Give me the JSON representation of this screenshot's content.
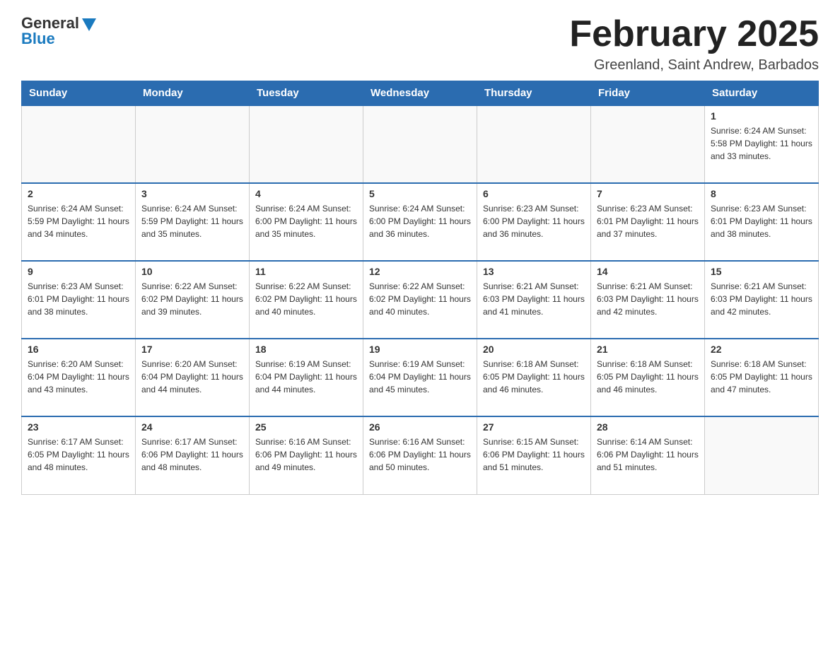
{
  "header": {
    "logo_general": "General",
    "logo_blue": "Blue",
    "month_title": "February 2025",
    "location": "Greenland, Saint Andrew, Barbados"
  },
  "calendar": {
    "days_of_week": [
      "Sunday",
      "Monday",
      "Tuesday",
      "Wednesday",
      "Thursday",
      "Friday",
      "Saturday"
    ],
    "weeks": [
      [
        {
          "day": "",
          "info": ""
        },
        {
          "day": "",
          "info": ""
        },
        {
          "day": "",
          "info": ""
        },
        {
          "day": "",
          "info": ""
        },
        {
          "day": "",
          "info": ""
        },
        {
          "day": "",
          "info": ""
        },
        {
          "day": "1",
          "info": "Sunrise: 6:24 AM\nSunset: 5:58 PM\nDaylight: 11 hours and 33 minutes."
        }
      ],
      [
        {
          "day": "2",
          "info": "Sunrise: 6:24 AM\nSunset: 5:59 PM\nDaylight: 11 hours and 34 minutes."
        },
        {
          "day": "3",
          "info": "Sunrise: 6:24 AM\nSunset: 5:59 PM\nDaylight: 11 hours and 35 minutes."
        },
        {
          "day": "4",
          "info": "Sunrise: 6:24 AM\nSunset: 6:00 PM\nDaylight: 11 hours and 35 minutes."
        },
        {
          "day": "5",
          "info": "Sunrise: 6:24 AM\nSunset: 6:00 PM\nDaylight: 11 hours and 36 minutes."
        },
        {
          "day": "6",
          "info": "Sunrise: 6:23 AM\nSunset: 6:00 PM\nDaylight: 11 hours and 36 minutes."
        },
        {
          "day": "7",
          "info": "Sunrise: 6:23 AM\nSunset: 6:01 PM\nDaylight: 11 hours and 37 minutes."
        },
        {
          "day": "8",
          "info": "Sunrise: 6:23 AM\nSunset: 6:01 PM\nDaylight: 11 hours and 38 minutes."
        }
      ],
      [
        {
          "day": "9",
          "info": "Sunrise: 6:23 AM\nSunset: 6:01 PM\nDaylight: 11 hours and 38 minutes."
        },
        {
          "day": "10",
          "info": "Sunrise: 6:22 AM\nSunset: 6:02 PM\nDaylight: 11 hours and 39 minutes."
        },
        {
          "day": "11",
          "info": "Sunrise: 6:22 AM\nSunset: 6:02 PM\nDaylight: 11 hours and 40 minutes."
        },
        {
          "day": "12",
          "info": "Sunrise: 6:22 AM\nSunset: 6:02 PM\nDaylight: 11 hours and 40 minutes."
        },
        {
          "day": "13",
          "info": "Sunrise: 6:21 AM\nSunset: 6:03 PM\nDaylight: 11 hours and 41 minutes."
        },
        {
          "day": "14",
          "info": "Sunrise: 6:21 AM\nSunset: 6:03 PM\nDaylight: 11 hours and 42 minutes."
        },
        {
          "day": "15",
          "info": "Sunrise: 6:21 AM\nSunset: 6:03 PM\nDaylight: 11 hours and 42 minutes."
        }
      ],
      [
        {
          "day": "16",
          "info": "Sunrise: 6:20 AM\nSunset: 6:04 PM\nDaylight: 11 hours and 43 minutes."
        },
        {
          "day": "17",
          "info": "Sunrise: 6:20 AM\nSunset: 6:04 PM\nDaylight: 11 hours and 44 minutes."
        },
        {
          "day": "18",
          "info": "Sunrise: 6:19 AM\nSunset: 6:04 PM\nDaylight: 11 hours and 44 minutes."
        },
        {
          "day": "19",
          "info": "Sunrise: 6:19 AM\nSunset: 6:04 PM\nDaylight: 11 hours and 45 minutes."
        },
        {
          "day": "20",
          "info": "Sunrise: 6:18 AM\nSunset: 6:05 PM\nDaylight: 11 hours and 46 minutes."
        },
        {
          "day": "21",
          "info": "Sunrise: 6:18 AM\nSunset: 6:05 PM\nDaylight: 11 hours and 46 minutes."
        },
        {
          "day": "22",
          "info": "Sunrise: 6:18 AM\nSunset: 6:05 PM\nDaylight: 11 hours and 47 minutes."
        }
      ],
      [
        {
          "day": "23",
          "info": "Sunrise: 6:17 AM\nSunset: 6:05 PM\nDaylight: 11 hours and 48 minutes."
        },
        {
          "day": "24",
          "info": "Sunrise: 6:17 AM\nSunset: 6:06 PM\nDaylight: 11 hours and 48 minutes."
        },
        {
          "day": "25",
          "info": "Sunrise: 6:16 AM\nSunset: 6:06 PM\nDaylight: 11 hours and 49 minutes."
        },
        {
          "day": "26",
          "info": "Sunrise: 6:16 AM\nSunset: 6:06 PM\nDaylight: 11 hours and 50 minutes."
        },
        {
          "day": "27",
          "info": "Sunrise: 6:15 AM\nSunset: 6:06 PM\nDaylight: 11 hours and 51 minutes."
        },
        {
          "day": "28",
          "info": "Sunrise: 6:14 AM\nSunset: 6:06 PM\nDaylight: 11 hours and 51 minutes."
        },
        {
          "day": "",
          "info": ""
        }
      ]
    ]
  }
}
